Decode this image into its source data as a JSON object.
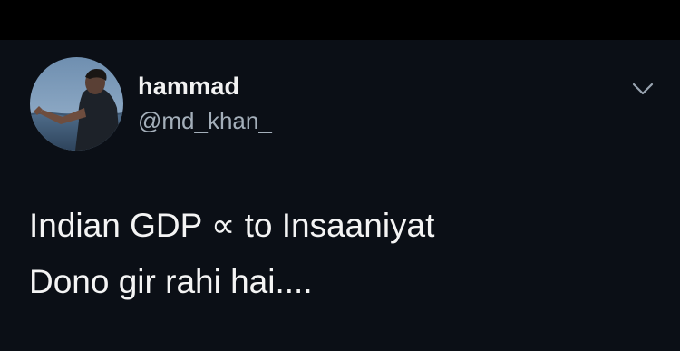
{
  "tweet": {
    "author": {
      "display_name": "hammad",
      "handle": "@md_khan_",
      "avatar_icon": "profile-photo-avatar"
    },
    "menu_icon": "chevron-down-icon",
    "text_lines": [
      "Indian GDP ∝ to Insaaniyat",
      "Dono gir rahi hai...."
    ]
  },
  "colors": {
    "page_background": "#000000",
    "card_background": "#0b0f16",
    "primary_text": "#f2f2f2",
    "secondary_text": "#a4afba"
  }
}
